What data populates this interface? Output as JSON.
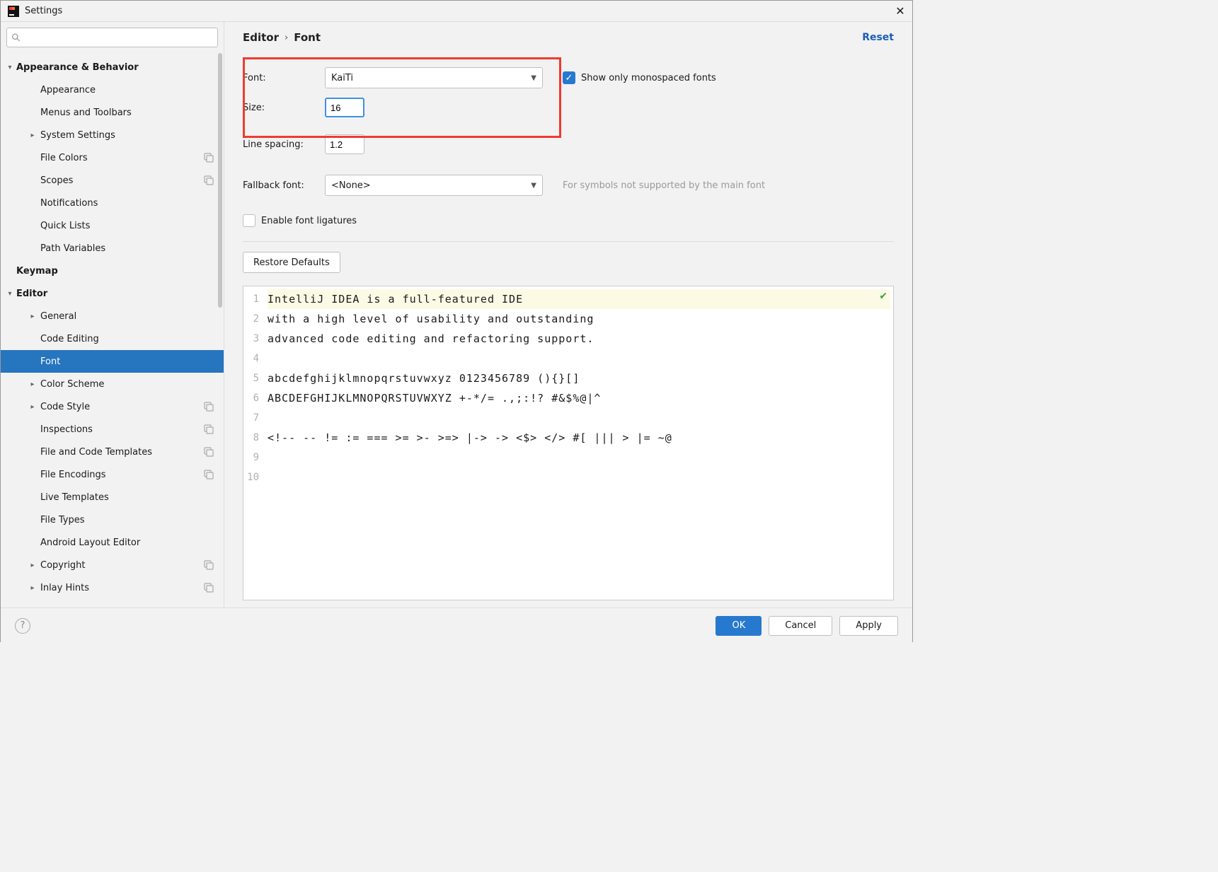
{
  "window": {
    "title": "Settings"
  },
  "sidebar": {
    "search_placeholder": "",
    "items": [
      {
        "label": "Appearance & Behavior",
        "level": 1,
        "arrow": "down"
      },
      {
        "label": "Appearance",
        "level": 2
      },
      {
        "label": "Menus and Toolbars",
        "level": 2
      },
      {
        "label": "System Settings",
        "level": 2,
        "arrow": "right"
      },
      {
        "label": "File Colors",
        "level": 2,
        "tail": true
      },
      {
        "label": "Scopes",
        "level": 2,
        "tail": true
      },
      {
        "label": "Notifications",
        "level": 2
      },
      {
        "label": "Quick Lists",
        "level": 2
      },
      {
        "label": "Path Variables",
        "level": 2
      },
      {
        "label": "Keymap",
        "level": 1
      },
      {
        "label": "Editor",
        "level": 1,
        "arrow": "down"
      },
      {
        "label": "General",
        "level": 2,
        "arrow": "right"
      },
      {
        "label": "Code Editing",
        "level": 2
      },
      {
        "label": "Font",
        "level": 2,
        "selected": true
      },
      {
        "label": "Color Scheme",
        "level": 2,
        "arrow": "right"
      },
      {
        "label": "Code Style",
        "level": 2,
        "arrow": "right",
        "tail": true
      },
      {
        "label": "Inspections",
        "level": 2,
        "tail": true
      },
      {
        "label": "File and Code Templates",
        "level": 2,
        "tail": true
      },
      {
        "label": "File Encodings",
        "level": 2,
        "tail": true
      },
      {
        "label": "Live Templates",
        "level": 2
      },
      {
        "label": "File Types",
        "level": 2
      },
      {
        "label": "Android Layout Editor",
        "level": 2
      },
      {
        "label": "Copyright",
        "level": 2,
        "arrow": "right",
        "tail": true
      },
      {
        "label": "Inlay Hints",
        "level": 2,
        "arrow": "right",
        "tail": true
      }
    ]
  },
  "breadcrumb": {
    "segment1": "Editor",
    "segment2": "Font"
  },
  "actions": {
    "reset": "Reset"
  },
  "form": {
    "font_label": "Font:",
    "font_value": "KaiTi",
    "size_label": "Size:",
    "size_value": "16",
    "line_spacing_label": "Line spacing:",
    "line_spacing_value": "1.2",
    "fallback_label": "Fallback font:",
    "fallback_value": "<None>",
    "fallback_hint": "For symbols not supported by the main font",
    "monospaced_checkbox_label": "Show only monospaced fonts",
    "monospaced_checked": true,
    "ligatures_label": "Enable font ligatures",
    "ligatures_checked": false,
    "restore_defaults": "Restore Defaults"
  },
  "preview": {
    "lines": [
      "IntelliJ IDEA is a full-featured IDE",
      "with a high level of usability and outstanding",
      "advanced code editing and refactoring support.",
      "",
      "abcdefghijklmnopqrstuvwxyz 0123456789 (){}[]",
      "ABCDEFGHIJKLMNOPQRSTUVWXYZ +-*/= .,;:!? #&$%@|^",
      "",
      "<!-- -- != := === >= >- >=> |-> -> <$> </> #[ ||| > |= ~@",
      "",
      ""
    ]
  },
  "buttons": {
    "ok": "OK",
    "cancel": "Cancel",
    "apply": "Apply"
  }
}
